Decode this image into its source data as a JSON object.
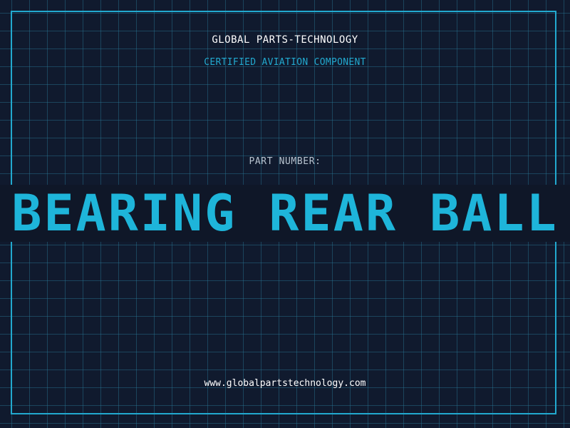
{
  "header": {
    "company": "GLOBAL PARTS-TECHNOLOGY",
    "tagline": "CERTIFIED AVIATION COMPONENT"
  },
  "part": {
    "label": "PART NUMBER:",
    "value": "BEARING REAR BALL"
  },
  "footer": {
    "url": "www.globalpartstechnology.com"
  },
  "colors": {
    "background": "#101a2e",
    "accent": "#22a9cf",
    "grid": "#28789a",
    "text": "#ffffff"
  }
}
